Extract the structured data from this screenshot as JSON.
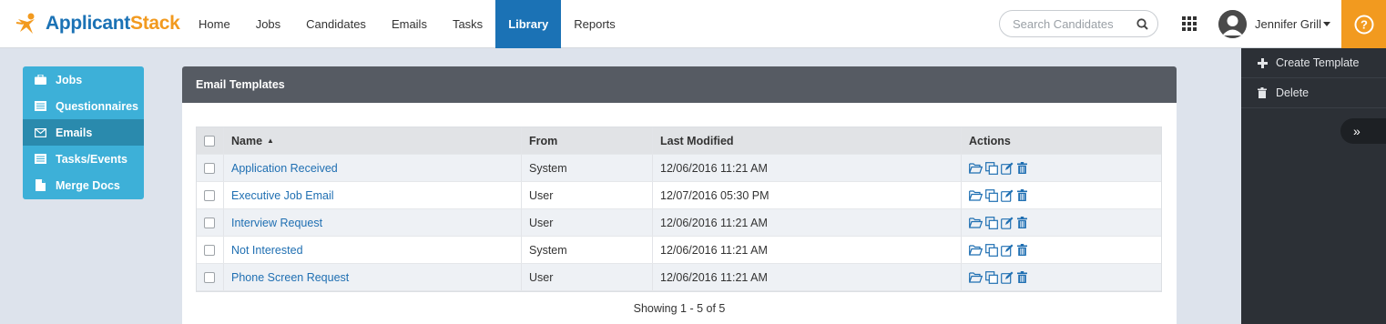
{
  "brand": {
    "name_part1": "Applicant",
    "name_part2": "Stack"
  },
  "nav": {
    "items": [
      "Home",
      "Jobs",
      "Candidates",
      "Emails",
      "Tasks",
      "Library",
      "Reports"
    ],
    "active": "Library"
  },
  "search": {
    "placeholder": "Search Candidates"
  },
  "user": {
    "name": "Jennifer Grill"
  },
  "sidebar": {
    "items": [
      {
        "label": "Jobs",
        "icon": "briefcase-icon"
      },
      {
        "label": "Questionnaires",
        "icon": "list-icon"
      },
      {
        "label": "Emails",
        "icon": "envelope-icon"
      },
      {
        "label": "Tasks/Events",
        "icon": "list-icon"
      },
      {
        "label": "Merge Docs",
        "icon": "document-icon"
      }
    ],
    "active": "Emails"
  },
  "panel": {
    "title": "Email Templates",
    "columns": {
      "name": "Name",
      "from": "From",
      "modified": "Last Modified",
      "actions": "Actions"
    },
    "rows": [
      {
        "name": "Application Received",
        "from": "System",
        "modified": "12/06/2016 11:21 AM"
      },
      {
        "name": "Executive Job Email",
        "from": "User",
        "modified": "12/07/2016 05:30 PM"
      },
      {
        "name": "Interview Request",
        "from": "User",
        "modified": "12/06/2016 11:21 AM"
      },
      {
        "name": "Not Interested",
        "from": "System",
        "modified": "12/06/2016 11:21 AM"
      },
      {
        "name": "Phone Screen Request",
        "from": "User",
        "modified": "12/06/2016 11:21 AM"
      }
    ],
    "showing": "Showing 1 - 5 of 5"
  },
  "right_panel": {
    "items": [
      {
        "label": "Create Template",
        "icon": "plus-icon"
      },
      {
        "label": "Delete",
        "icon": "trash-icon"
      }
    ],
    "collapse_glyph": "»"
  },
  "colors": {
    "primary": "#1b72b5",
    "accent": "#f29a1f",
    "sidebar": "#3db0d8",
    "header": "#565b63"
  }
}
